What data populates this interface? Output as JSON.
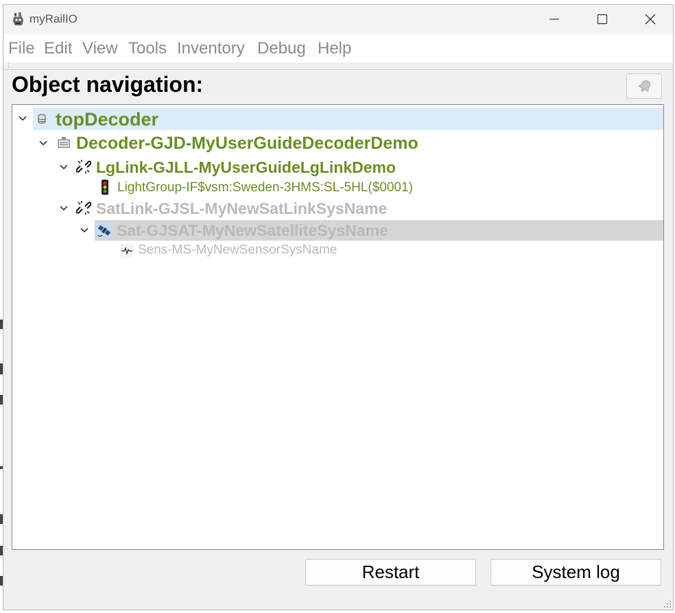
{
  "window": {
    "title": "myRailIO"
  },
  "menu": [
    "File",
    "Edit",
    "View",
    "Tools",
    "Inventory",
    "Debug",
    "Help"
  ],
  "heading": "Object navigation:",
  "tree": [
    {
      "label": "topDecoder",
      "icon": "database-icon",
      "color": "#6b8e23",
      "state": "selected"
    },
    {
      "label": "Decoder-GJD-MyUserGuideDecoderDemo",
      "icon": "decoder-board-icon",
      "color": "#6b8e23"
    },
    {
      "label": "LgLink-GJLL-MyUserGuideLgLinkDemo",
      "icon": "broken-link-icon",
      "color": "#6b8e23"
    },
    {
      "label": "LightGroup-IF$vsm:Sweden-3HMS:SL-5HL($0001)",
      "icon": "traffic-light-icon",
      "color": "#6b8e23"
    },
    {
      "label": "SatLink-GJSL-MyNewSatLinkSysName",
      "icon": "broken-link-icon",
      "color": "#b9b9b9"
    },
    {
      "label": "Sat-GJSAT-MyNewSatelliteSysName",
      "icon": "satellite-icon",
      "color": "#b9b9b9",
      "state": "highlighted"
    },
    {
      "label": "Sens-MS-MyNewSensorSysName",
      "icon": "sensor-signal-icon",
      "color": "#b9b9b9"
    }
  ],
  "buttons": {
    "restart": "Restart",
    "system_log": "System log"
  },
  "colors": {
    "active": "#6b8e23",
    "inactive": "#b9b9b9",
    "selection": "#dcecfa",
    "highlight": "#d6d6d6"
  }
}
